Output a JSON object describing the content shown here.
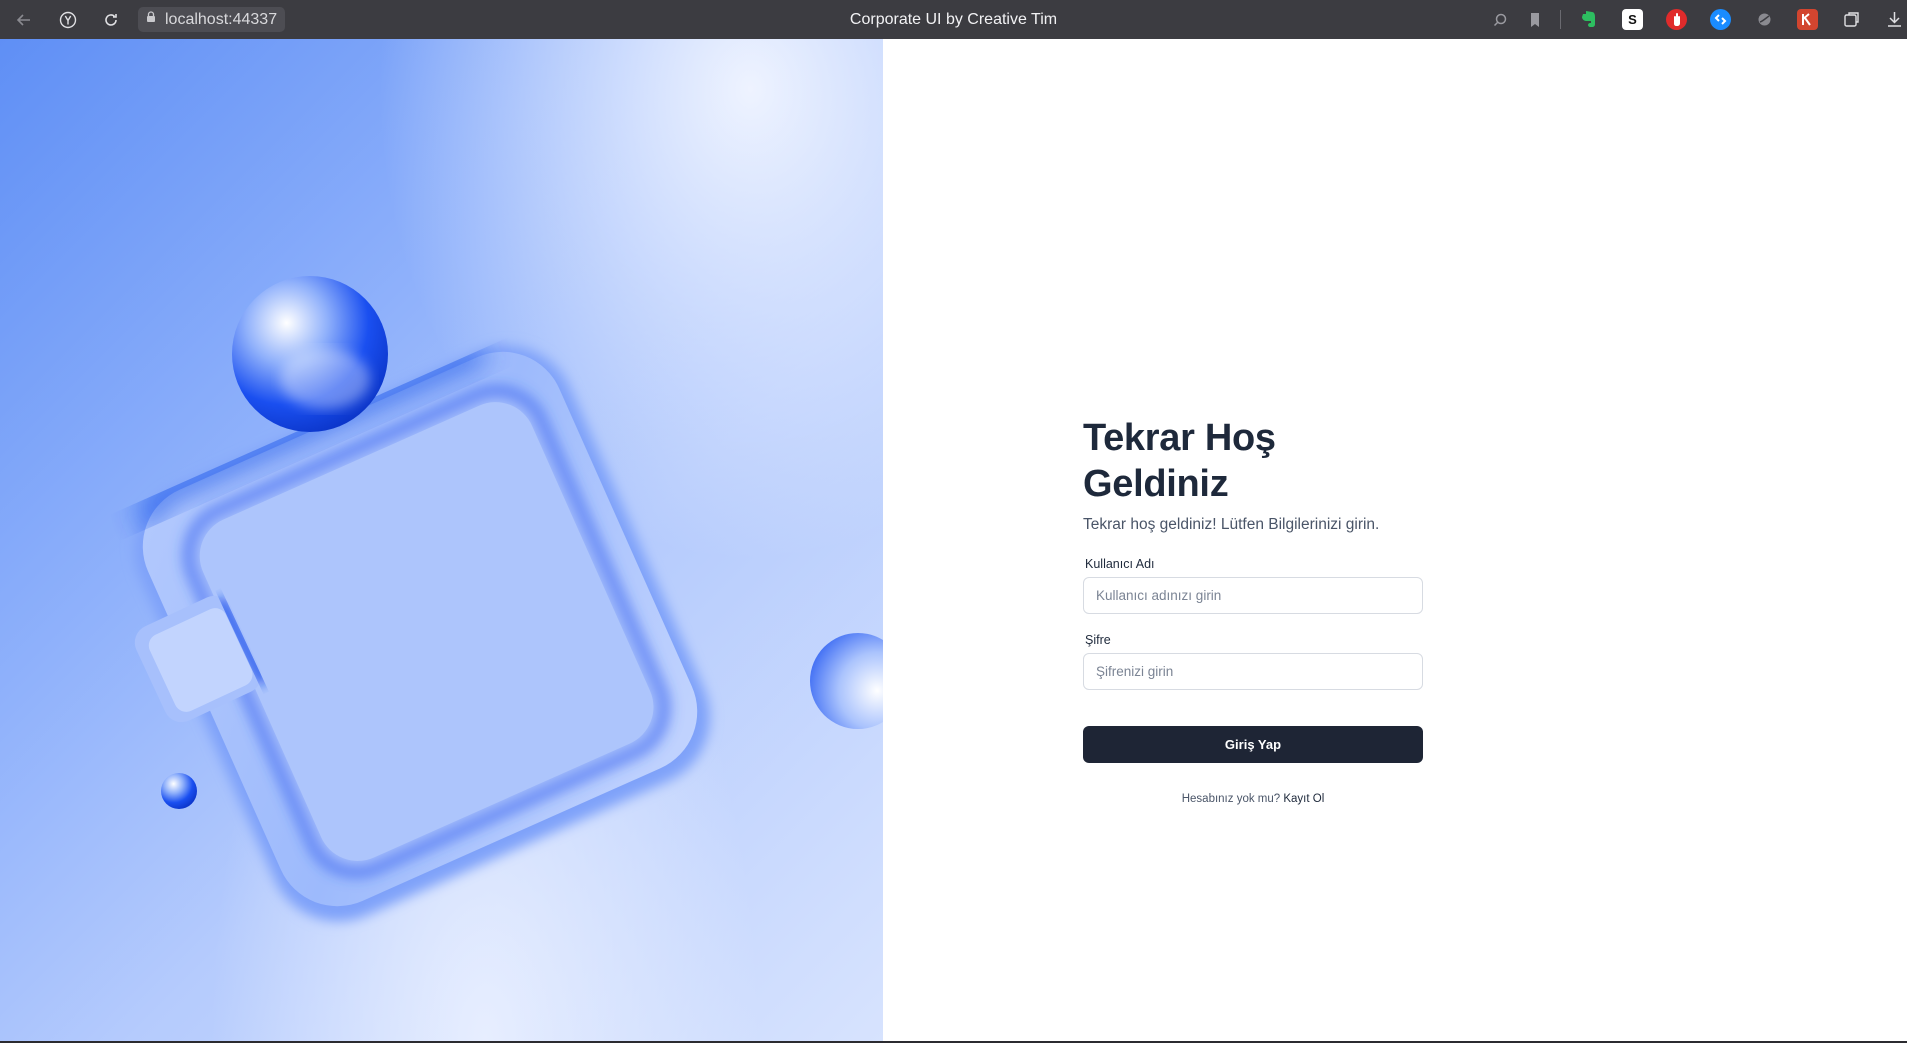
{
  "browser": {
    "url": "localhost:44337",
    "title": "Corporate UI by Creative Tim",
    "icons": [
      "back-icon",
      "yandex-icon",
      "reload-icon",
      "lock-icon",
      "search-icon",
      "bookmark-icon",
      "evernote-icon",
      "s-extension-icon",
      "hand-extension-icon",
      "shazam-icon",
      "extension-icon",
      "k-extension-icon",
      "collections-icon",
      "download-icon"
    ],
    "ext_s_label": "S"
  },
  "login": {
    "heading": "Tekrar Hoş Geldiniz",
    "subtitle": "Tekrar hoş geldiniz! Lütfen Bilgilerinizi girin.",
    "username_label": "Kullanıcı Adı",
    "username_placeholder": "Kullanıcı adınızı girin",
    "username_value": "",
    "password_label": "Şifre",
    "password_placeholder": "Şifrenizi girin",
    "password_value": "",
    "submit_label": "Giriş Yap",
    "signup_prompt": "Hesabınız yok mu?",
    "signup_link": "Kayıt Ol"
  },
  "colors": {
    "primary": "#1e2535",
    "heading": "#1e293b",
    "hero_blue": "#2563eb"
  }
}
